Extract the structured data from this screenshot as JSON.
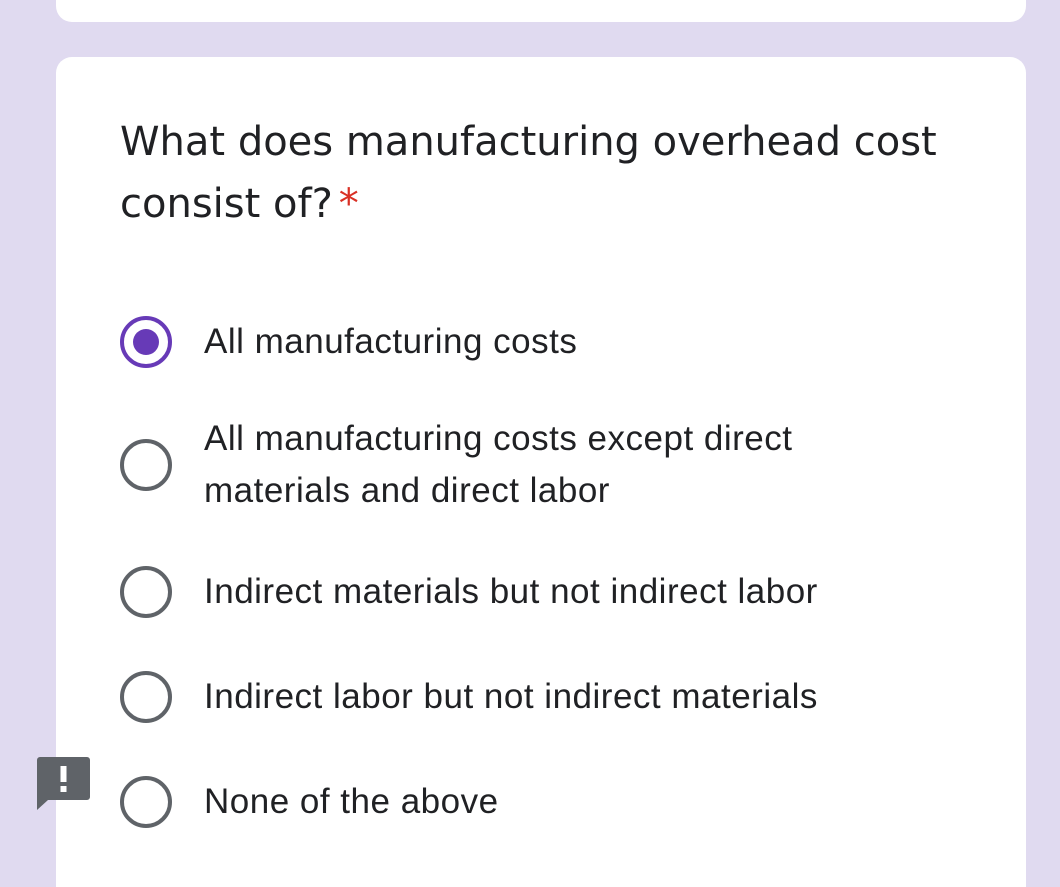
{
  "question": {
    "title": "What does manufacturing overhead cost consist of?",
    "required_marker": "*"
  },
  "options": [
    {
      "label": "All manufacturing costs",
      "selected": true
    },
    {
      "label": "All manufacturing costs except direct materials and direct labor",
      "selected": false
    },
    {
      "label": "Indirect materials but not indirect labor",
      "selected": false
    },
    {
      "label": "Indirect labor but not indirect materials",
      "selected": false
    },
    {
      "label": "None of the above",
      "selected": false
    }
  ],
  "colors": {
    "background": "#e0daf0",
    "accent": "#673ab7",
    "required": "#d93025",
    "text": "#202124"
  },
  "icons": {
    "feedback": "report-feedback-icon"
  }
}
